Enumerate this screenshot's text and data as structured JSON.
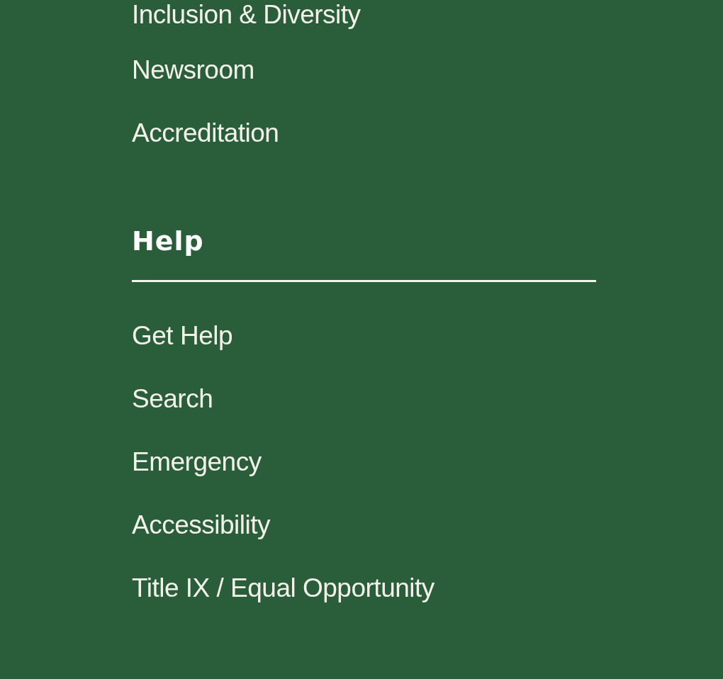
{
  "sections": [
    {
      "links": [
        "Inclusion & Diversity",
        "Newsroom",
        "Accreditation"
      ]
    },
    {
      "heading": "Help",
      "links": [
        "Get Help",
        "Search",
        "Emergency",
        "Accessibility",
        "Title IX / Equal Opportunity"
      ]
    }
  ]
}
